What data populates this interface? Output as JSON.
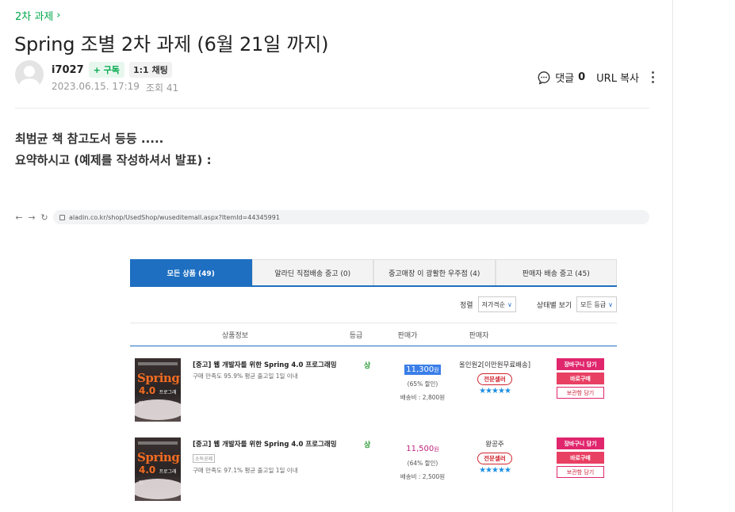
{
  "breadcrumb": {
    "label": "2차 과제",
    "chevron": "›"
  },
  "post": {
    "title": "Spring 조별 2차 과제 (6월 21일 까지)",
    "author": "i7027",
    "subscribe_label": "+ 구독",
    "chat_label": "1:1 채팅",
    "date": "2023.06.15. 17:19",
    "views_label": "조회 41",
    "comments_label": "댓글",
    "comments_count": "0",
    "url_copy_label": "URL 복사",
    "body_lines": [
      "최범균 책 참고도서  등등 .....",
      "요약하시고 (예제를 작성하셔서 발표) :"
    ]
  },
  "embed": {
    "url": "aladin.co.kr/shop/UsedShop/wuseditemall.aspx?ItemId=44345991",
    "tabs": [
      {
        "label": "모든 상품 (49)",
        "active": true
      },
      {
        "label": "알라딘 직접배송 중고 (0)",
        "active": false
      },
      {
        "label": "중고매장 이 광활한 우주점 (4)",
        "active": false
      },
      {
        "label": "판매자 배송 중고 (45)",
        "active": false
      }
    ],
    "filters": {
      "sort_label": "정렬",
      "sort_value": "저가격순",
      "state_label": "상태별 보기",
      "state_value": "모든 등급"
    },
    "columns": [
      "상품정보",
      "등급",
      "판매가",
      "판매자"
    ],
    "rows": [
      {
        "cover_title": "Spring",
        "cover_version": "4.0",
        "cover_sub": "프로그래밍",
        "name": "[중고] 웹 개발자를 위한 Spring 4.0 프로그래밍",
        "tag": "",
        "stat": "구매 만족도 95.9%    평균 출고일 1일 이내",
        "grade": "상",
        "price": "11,300",
        "price_unit": "원",
        "discount": "(65% 할인)",
        "shipping": "배송비 : 2,800원",
        "seller": "올인원2[이만원무료배송]",
        "seller_badge": "전문셀러",
        "stars": "★★★★★",
        "cart_label": "장바구니 담기",
        "buy_label": "바로구매",
        "keep_label": "보관함 담기"
      },
      {
        "cover_title": "Spring",
        "cover_version": "4.0",
        "cover_sub": "프로그래밍",
        "name": "[중고] 웹 개발자를 위한 Spring 4.0 프로그래밍",
        "tag": "소득공제",
        "stat": "구매 만족도 97.1%    평균 출고일 1일 이내",
        "grade": "상",
        "price": "11,500",
        "price_unit": "원",
        "discount": "(64% 할인)",
        "shipping": "배송비 : 2,500원",
        "seller": "왕공주",
        "seller_badge": "전문셀러",
        "stars": "★★★★★",
        "cart_label": "장바구니 담기",
        "buy_label": "바로구매",
        "keep_label": "보관함 담기"
      }
    ]
  },
  "colors": {
    "accent_green": "#03a94d",
    "tab_blue": "#1e6fc1",
    "price_pink": "#c0257d",
    "cart_pink": "#e0266d"
  }
}
